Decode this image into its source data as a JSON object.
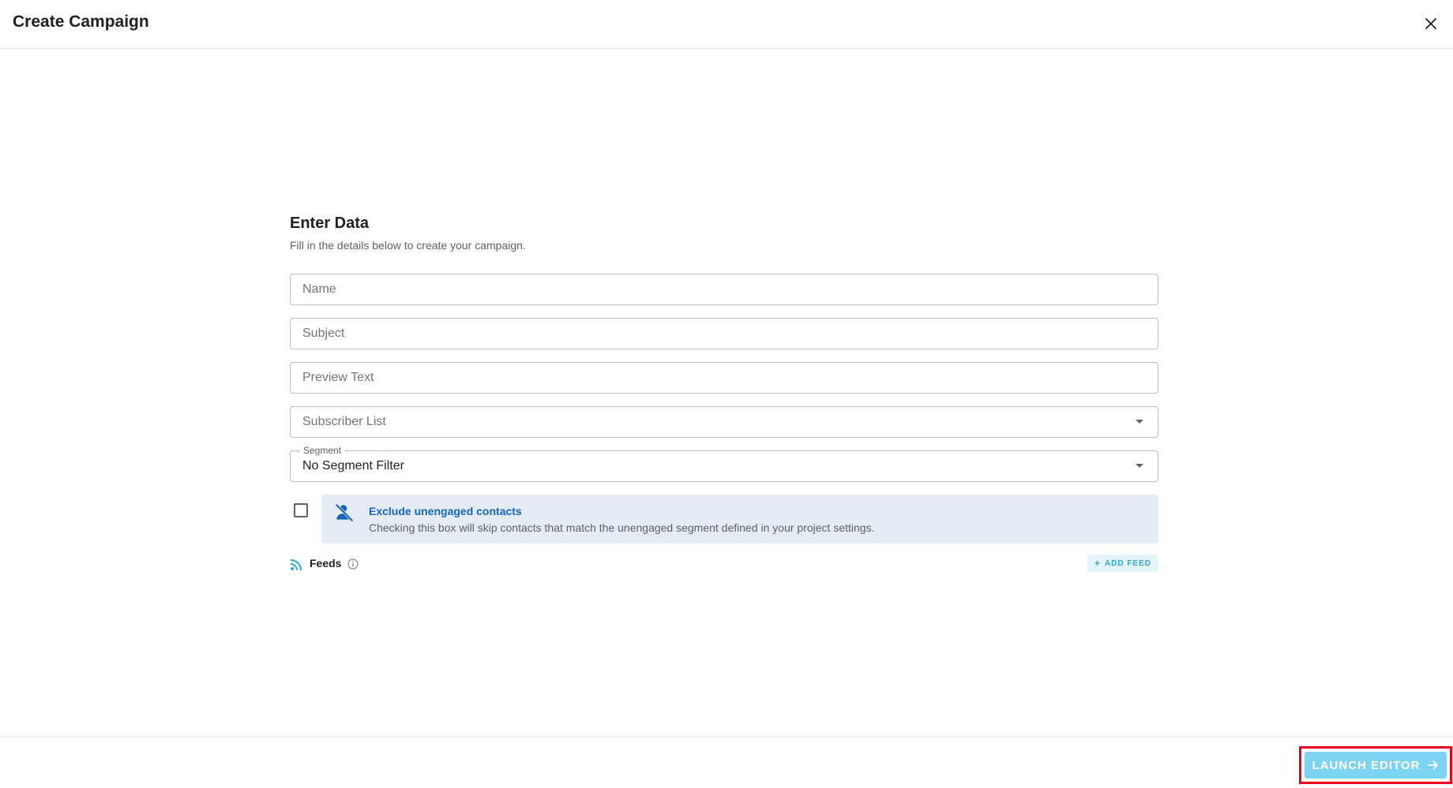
{
  "header": {
    "title": "Create Campaign"
  },
  "form": {
    "title": "Enter Data",
    "subtitle": "Fill in the details below to create your campaign.",
    "name_placeholder": "Name",
    "subject_placeholder": "Subject",
    "preview_text_placeholder": "Preview Text",
    "subscriber_list_placeholder": "Subscriber List",
    "segment": {
      "label": "Segment",
      "value": "No Segment Filter"
    },
    "exclude": {
      "checked": false,
      "title": "Exclude unengaged contacts",
      "description": "Checking this box will skip contacts that match the unengaged segment defined in your project settings."
    },
    "feeds": {
      "label": "Feeds",
      "add_label": "ADD FEED"
    }
  },
  "footer": {
    "launch_label": "LAUNCH EDITOR"
  },
  "icons": {
    "close": "close-icon",
    "user_off": "person-off-icon",
    "rss": "rss-icon",
    "info": "info-icon",
    "plus": "plus-icon",
    "arrow": "arrow-right-icon"
  },
  "colors": {
    "accent": "#29a8d8",
    "launch_button": "#7dd3f2",
    "info_box_bg": "#e4ebf5",
    "info_title": "#1565c0",
    "highlight_border": "#e8001b"
  }
}
